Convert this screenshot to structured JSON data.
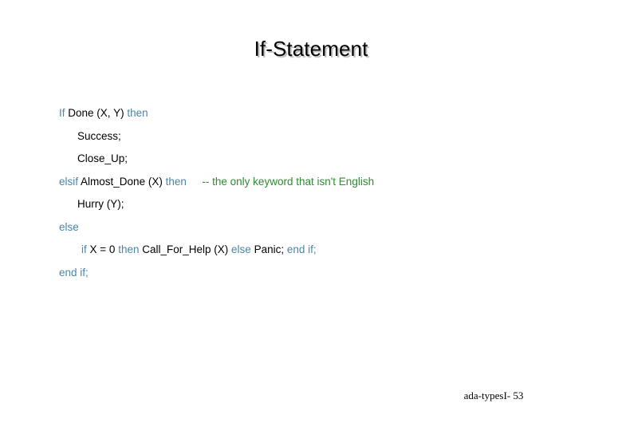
{
  "slide": {
    "title": "If-Statement",
    "footer": "ada-typesI- 53",
    "colors": {
      "keyword": "#4a86a8",
      "identifier": "#000000",
      "comment": "#2f8a32",
      "title": "#000000",
      "title_shadow": "#bfbfbf",
      "background": "#ffffff"
    },
    "code": {
      "line1": {
        "kw_if": "If",
        "call": "Done (X, Y)",
        "kw_then": "then"
      },
      "line2": {
        "stmt": "Success;"
      },
      "line3": {
        "stmt": "Close_Up;"
      },
      "line4": {
        "kw_elsif": "elsif",
        "call": "Almost_Done (X)",
        "kw_then": "then",
        "comment": "-- the only keyword that isn't English"
      },
      "line5": {
        "stmt": "Hurry (Y);"
      },
      "line6": {
        "kw_else": "else"
      },
      "line7": {
        "kw_if": "if",
        "cond": "X = 0",
        "kw_then": "then",
        "call": "Call_For_Help (X)",
        "kw_else": "else",
        "stmt": "Panic;",
        "kw_end_if": "end if;"
      },
      "line8": {
        "kw_end_if": "end if;"
      }
    }
  }
}
